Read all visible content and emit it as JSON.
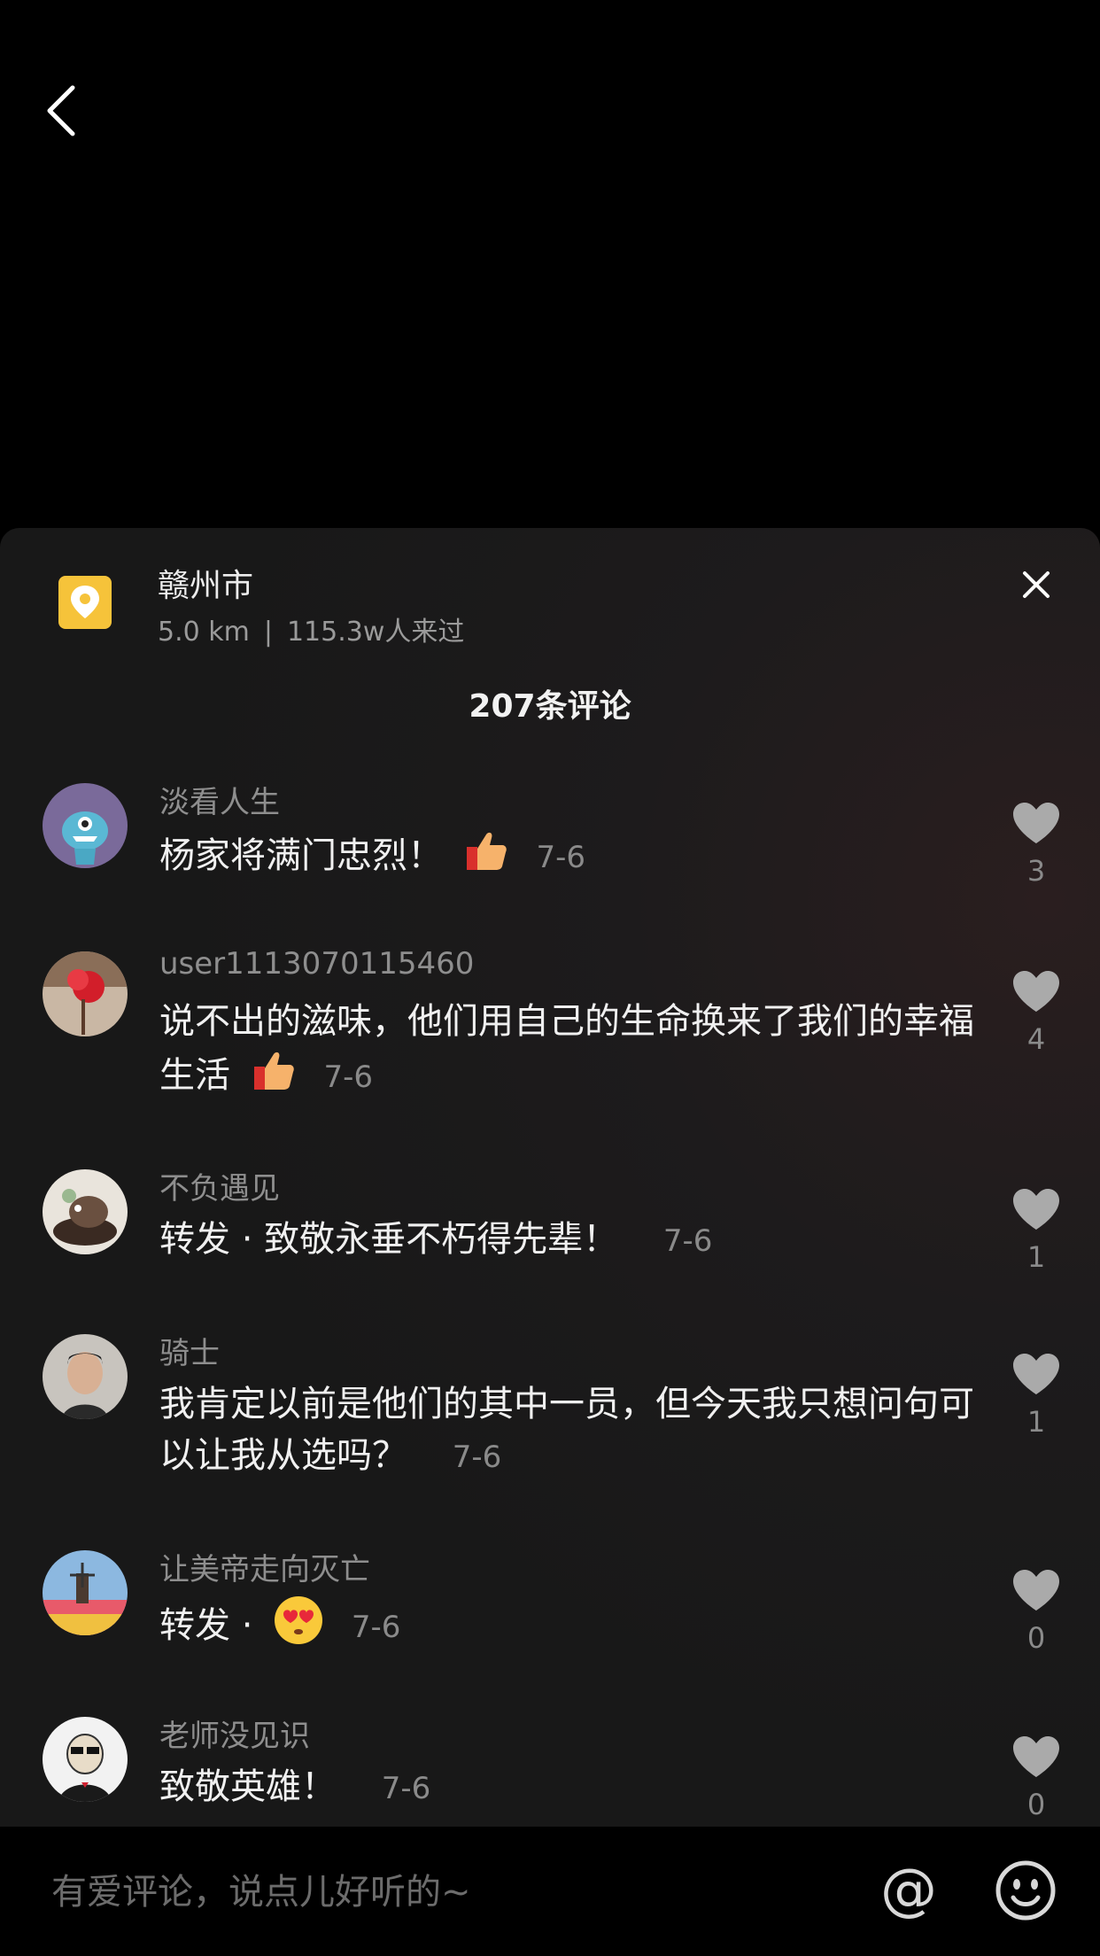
{
  "location": {
    "name": "赣州市",
    "distance": "5.0 km",
    "separator": "|",
    "visitors": "115.3w人来过"
  },
  "comment_count_label": "207条评论",
  "comments": [
    {
      "user": "淡看人生",
      "text": "杨家将满门忠烈！",
      "date": "7-6",
      "likes": "3"
    },
    {
      "user": "user1113070115460",
      "text": "说不出的滋味，他们用自己的生命换来了我们的幸福生活",
      "date": "7-6",
      "likes": "4"
    },
    {
      "user": "不负遇见",
      "text": "转发 · 致敬永垂不朽得先辈！",
      "date": "7-6",
      "likes": "1"
    },
    {
      "user": "骑士",
      "text": "我肯定以前是他们的其中一员，但今天我只想问句可以让我从选吗？",
      "date": "7-6",
      "likes": "1"
    },
    {
      "user": "让美帝走向灭亡",
      "text": "转发 ·",
      "date": "7-6",
      "likes": "0"
    },
    {
      "user": "老师没见识",
      "text": "致敬英雄！",
      "date": "7-6",
      "likes": "0"
    }
  ],
  "input": {
    "placeholder": "有爱评论，说点儿好听的~",
    "at_label": "@"
  },
  "colors": {
    "location_badge": "#f6c33a",
    "sheet_background": "#181818"
  }
}
